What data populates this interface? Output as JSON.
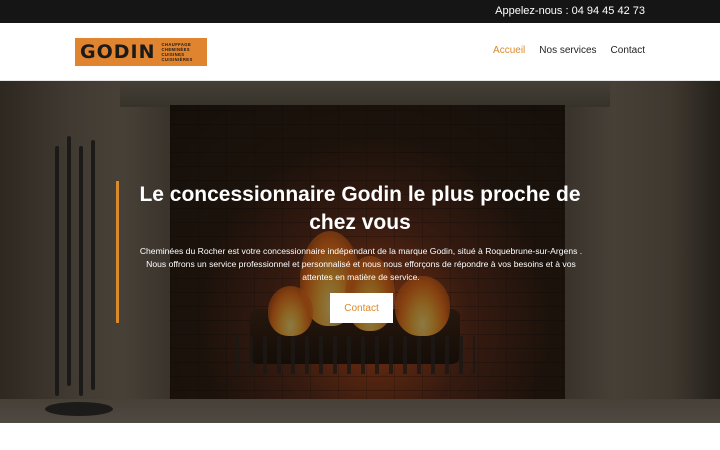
{
  "topbar": {
    "phone_text": "Appelez-nous : 04 94 45 42 73"
  },
  "header": {
    "logo": {
      "brand": "GODIN",
      "taglines": [
        "CHAUFFAGE",
        "CHEMINÉES",
        "CUISINES",
        "CUISINIÈRES"
      ]
    },
    "nav": [
      {
        "label": "Accueil",
        "active": true
      },
      {
        "label": "Nos services",
        "active": false
      },
      {
        "label": "Contact",
        "active": false
      }
    ]
  },
  "hero": {
    "headline": "Le concessionnaire Godin le plus proche de chez vous",
    "description": "Cheminées du Rocher est votre concessionnaire indépendant de la marque Godin, situé à Roquebrune-sur-Argens . Nous offrons un service professionnel et personnalisé et nous nous efforçons de répondre à vos besoins et à vos attentes en matière de service.",
    "cta_label": "Contact"
  },
  "colors": {
    "accent": "#d98a2b",
    "logo_bg": "#e1842f",
    "topbar_bg": "#151515"
  }
}
